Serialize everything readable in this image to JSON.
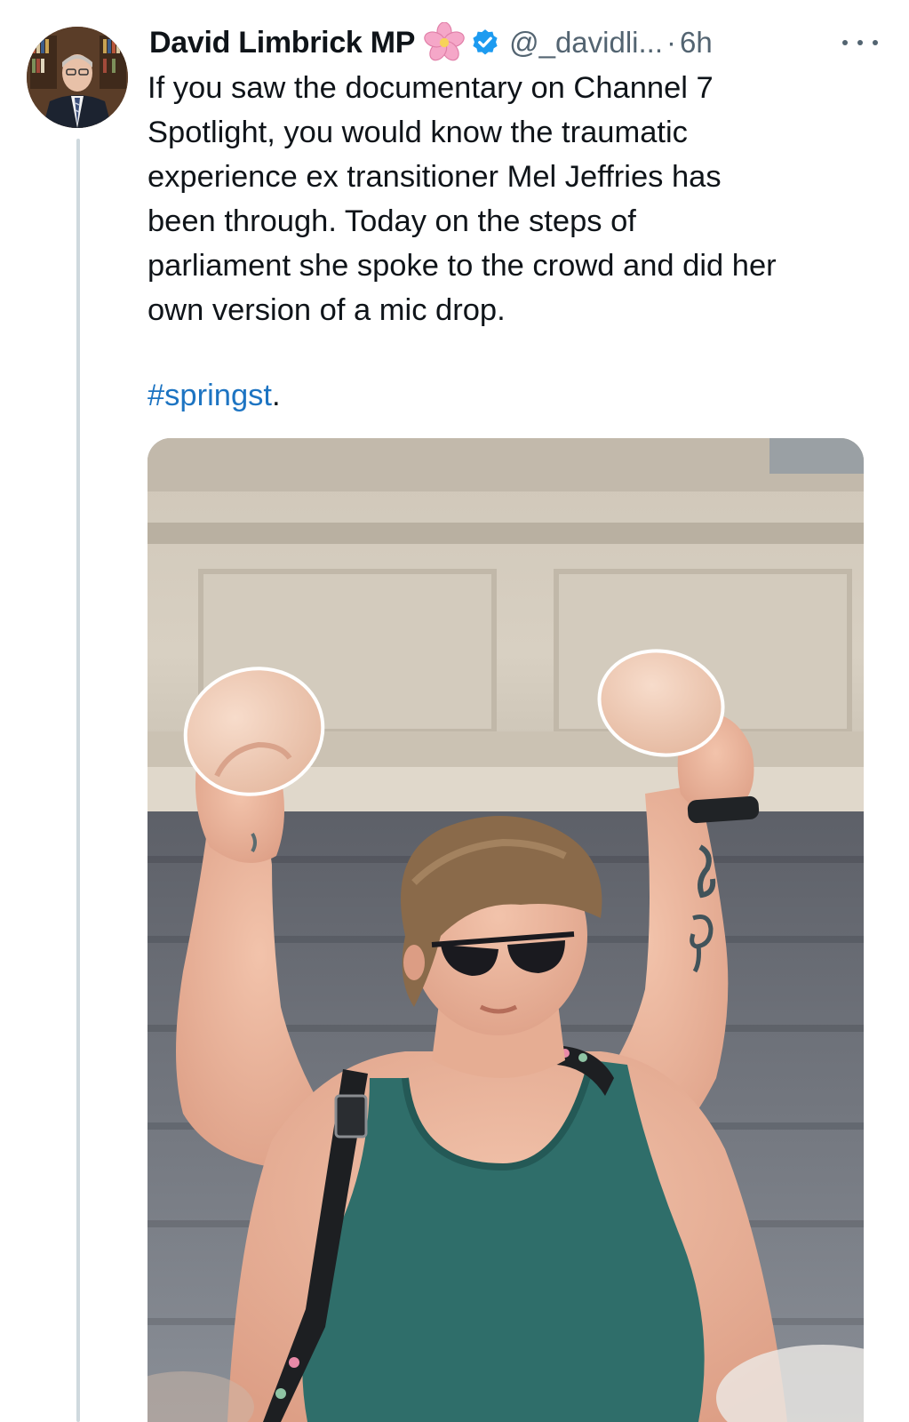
{
  "author": {
    "display_name": "David Limbrick MP",
    "name_emoji_icon": "cherry-blossom-icon",
    "verified_icon": "verified-badge-icon",
    "handle": "@_davidli...",
    "separator": "·",
    "timestamp": "6h"
  },
  "post": {
    "lines": [
      "If you saw the documentary on Channel 7",
      "Spotlight, you would know the traumatic",
      "experience ex transitioner Mel Jeffries has",
      "been through. Today on the steps of",
      "parliament she spoke to the crowd and did her",
      "own version of a mic drop."
    ],
    "hashtag": "#springst",
    "hashtag_suffix": "."
  },
  "actions": {
    "more_icon": "more-options-icon"
  },
  "colors": {
    "text": "#0f1419",
    "secondary": "#536471",
    "link": "#1d74c2",
    "verified": "#1d9bf0",
    "thread_line": "#cfd9de"
  }
}
